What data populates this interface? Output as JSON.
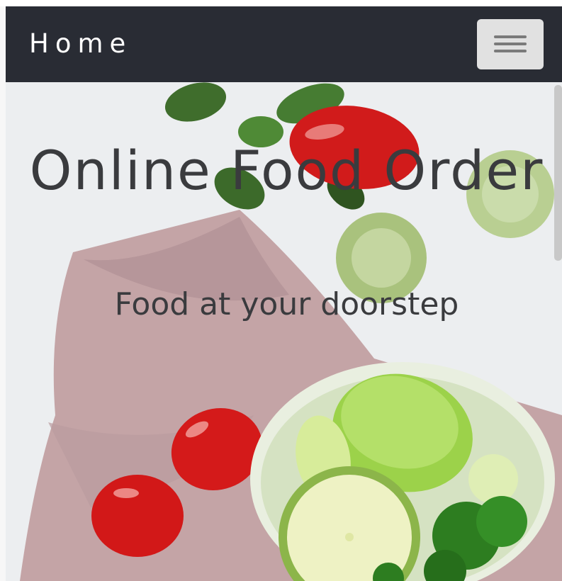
{
  "navbar": {
    "brand": "Home",
    "toggle_icon": "hamburger-menu-icon"
  },
  "hero": {
    "title": "Online Food Order",
    "subtitle": "Food at your doorstep",
    "background": "vegetables-photo"
  },
  "colors": {
    "navbar_bg": "#292c34",
    "brand_text": "#ffffff",
    "toggler_bg": "#e1e1e1",
    "hero_text": "#3a3b3e"
  }
}
